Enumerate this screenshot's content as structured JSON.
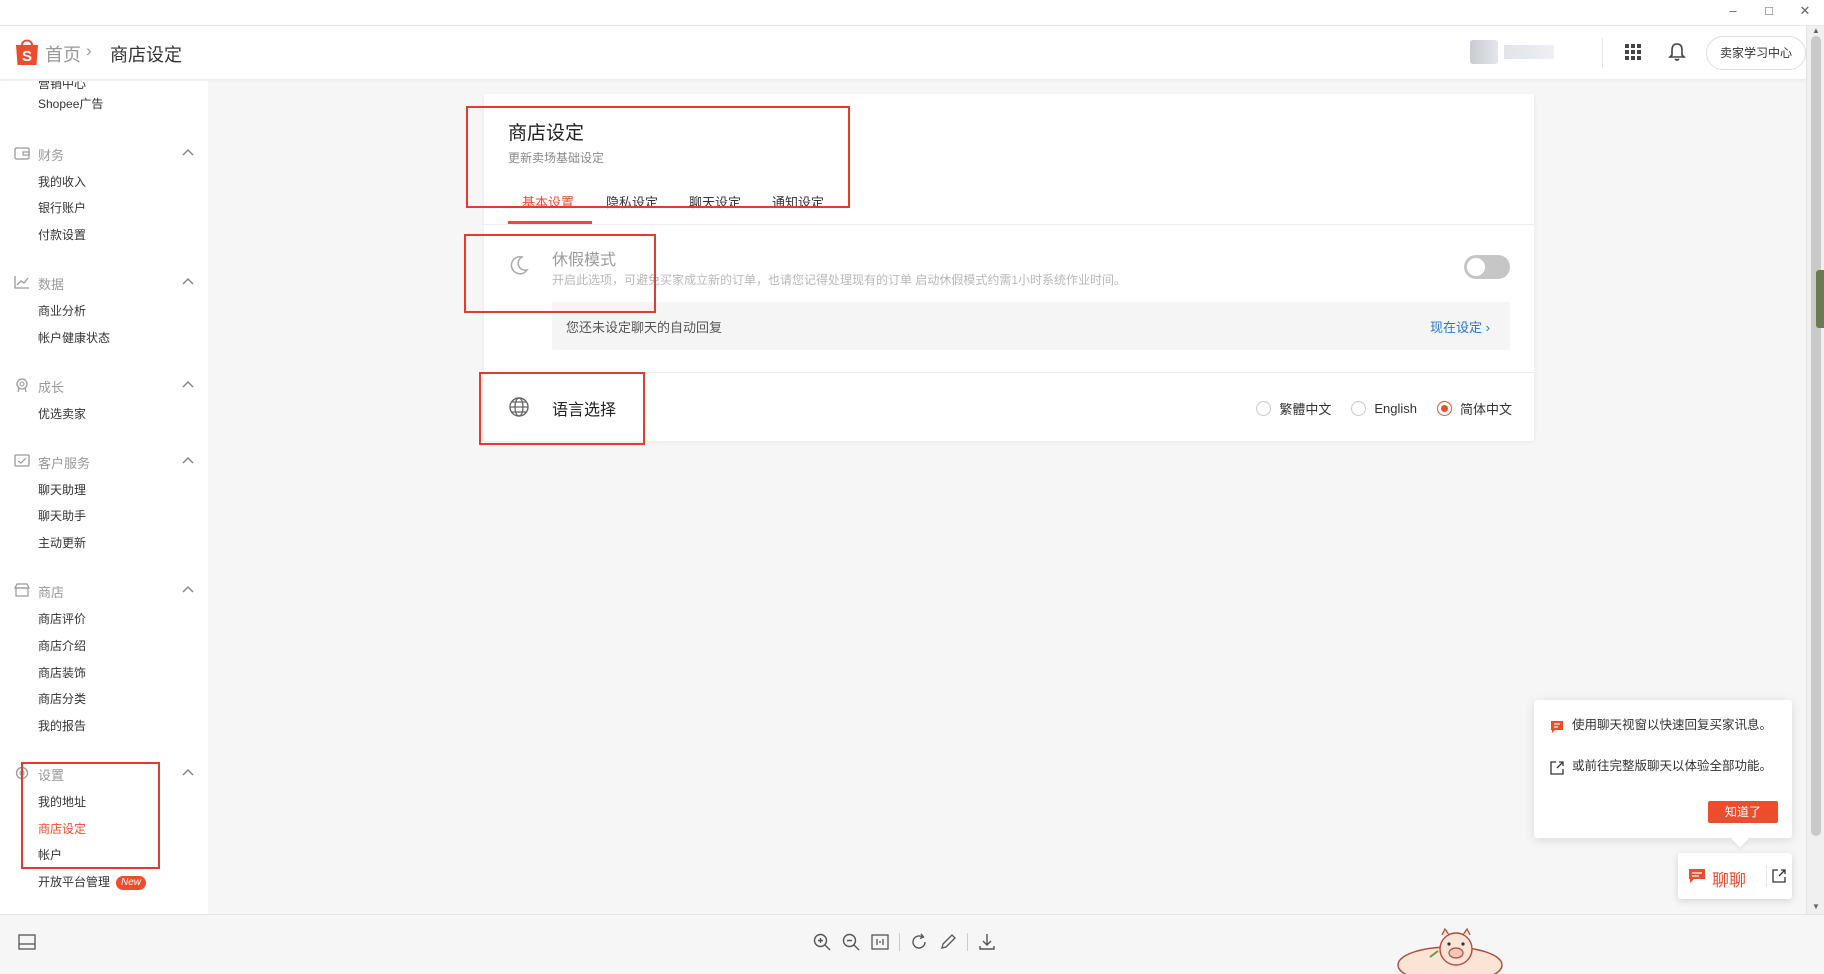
{
  "header": {
    "breadcrumb_home": "首页",
    "breadcrumb_sep": "›",
    "breadcrumb_current": "商店设定",
    "learning_center": "卖家学习中心"
  },
  "window": {
    "minimize": "–",
    "maximize": "□",
    "close": "✕"
  },
  "sidebar": {
    "cut_item": "营销中心",
    "shopee_ads": "Shopee广告",
    "sections": [
      {
        "label": "财务",
        "items": [
          "我的收入",
          "银行账户",
          "付款设置"
        ]
      },
      {
        "label": "数据",
        "items": [
          "商业分析",
          "帐户健康状态"
        ]
      },
      {
        "label": "成长",
        "items": [
          "优选卖家"
        ]
      },
      {
        "label": "客户服务",
        "items": [
          "聊天助理",
          "聊天助手",
          "主动更新"
        ]
      },
      {
        "label": "商店",
        "items": [
          "商店评价",
          "商店介绍",
          "商店装饰",
          "商店分类",
          "我的报告"
        ]
      },
      {
        "label": "设置",
        "items": [
          "我的地址",
          "商店设定",
          "帐户",
          "开放平台管理"
        ]
      }
    ],
    "new_badge": "New"
  },
  "card": {
    "title": "商店设定",
    "subtitle": "更新卖场基础设定",
    "tabs": [
      "基本设置",
      "隐私设定",
      "聊天设定",
      "通知设定"
    ],
    "vacation": {
      "title": "休假模式",
      "desc": "开启此选项，可避免买家成立新的订单，也请您记得处理现有的订单 启动休假模式约需1小时系统作业时间。",
      "enabled": false
    },
    "auto_reply": {
      "text": "您还未设定聊天的自动回复",
      "link": "现在设定",
      "chevron": "›"
    },
    "language": {
      "title": "语言选择",
      "options": [
        "繁體中文",
        "English",
        "简体中文"
      ],
      "selected": "简体中文"
    }
  },
  "chat_popup": {
    "line1": "使用聊天视窗以快速回复买家讯息。",
    "line2": "或前往完整版聊天以体验全部功能。",
    "got_it": "知道了"
  },
  "chat_button": {
    "label": "聊聊"
  },
  "colors": {
    "brand": "#ee4d2d",
    "link": "#2673dd",
    "annotation": "#e53a2e"
  }
}
